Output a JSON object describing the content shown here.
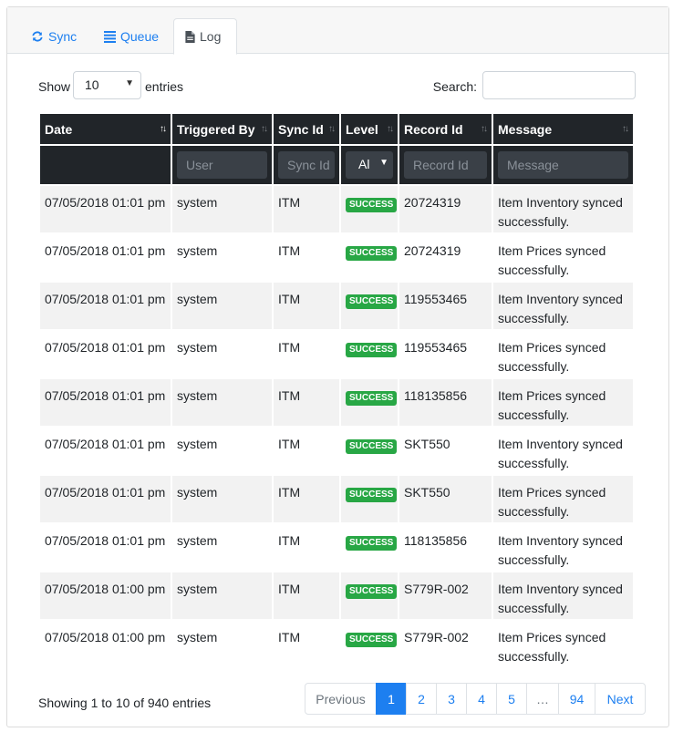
{
  "tabs": [
    {
      "label": "Sync",
      "icon": "sync-icon",
      "active": false
    },
    {
      "label": "Queue",
      "icon": "list-icon",
      "active": false
    },
    {
      "label": "Log",
      "icon": "file-icon",
      "active": true
    }
  ],
  "length": {
    "show_label": "Show",
    "value": "10",
    "entries_label": "entries"
  },
  "search": {
    "label": "Search:",
    "value": ""
  },
  "columns": [
    "Date",
    "Triggered By",
    "Sync Id",
    "Level",
    "Record Id",
    "Message"
  ],
  "filters": {
    "user_placeholder": "User",
    "sync_id_placeholder": "Sync Id",
    "level_value": "Al",
    "record_id_placeholder": "Record Id",
    "message_placeholder": "Message"
  },
  "rows": [
    {
      "date": "07/05/2018 01:01 pm",
      "triggered_by": "system",
      "sync_id": "ITM",
      "level": "SUCCESS",
      "record_id": "20724319",
      "message": "Item Inventory synced successfully."
    },
    {
      "date": "07/05/2018 01:01 pm",
      "triggered_by": "system",
      "sync_id": "ITM",
      "level": "SUCCESS",
      "record_id": "20724319",
      "message": "Item Prices synced successfully."
    },
    {
      "date": "07/05/2018 01:01 pm",
      "triggered_by": "system",
      "sync_id": "ITM",
      "level": "SUCCESS",
      "record_id": "119553465",
      "message": "Item Inventory synced successfully."
    },
    {
      "date": "07/05/2018 01:01 pm",
      "triggered_by": "system",
      "sync_id": "ITM",
      "level": "SUCCESS",
      "record_id": "119553465",
      "message": "Item Prices synced successfully."
    },
    {
      "date": "07/05/2018 01:01 pm",
      "triggered_by": "system",
      "sync_id": "ITM",
      "level": "SUCCESS",
      "record_id": "118135856",
      "message": "Item Prices synced successfully."
    },
    {
      "date": "07/05/2018 01:01 pm",
      "triggered_by": "system",
      "sync_id": "ITM",
      "level": "SUCCESS",
      "record_id": "SKT550",
      "message": "Item Inventory synced successfully."
    },
    {
      "date": "07/05/2018 01:01 pm",
      "triggered_by": "system",
      "sync_id": "ITM",
      "level": "SUCCESS",
      "record_id": "SKT550",
      "message": "Item Prices synced successfully."
    },
    {
      "date": "07/05/2018 01:01 pm",
      "triggered_by": "system",
      "sync_id": "ITM",
      "level": "SUCCESS",
      "record_id": "118135856",
      "message": "Item Inventory synced successfully."
    },
    {
      "date": "07/05/2018 01:00 pm",
      "triggered_by": "system",
      "sync_id": "ITM",
      "level": "SUCCESS",
      "record_id": "S779R-002",
      "message": "Item Inventory synced successfully."
    },
    {
      "date": "07/05/2018 01:00 pm",
      "triggered_by": "system",
      "sync_id": "ITM",
      "level": "SUCCESS",
      "record_id": "S779R-002",
      "message": "Item Prices synced successfully."
    }
  ],
  "info": "Showing 1 to 10 of 940 entries",
  "pagination": {
    "previous": "Previous",
    "pages": [
      "1",
      "2",
      "3",
      "4",
      "5",
      "…",
      "94"
    ],
    "active": "1",
    "next": "Next"
  },
  "colors": {
    "accent": "#1d7ff0",
    "header_bg": "#212529",
    "success": "#28a745"
  }
}
